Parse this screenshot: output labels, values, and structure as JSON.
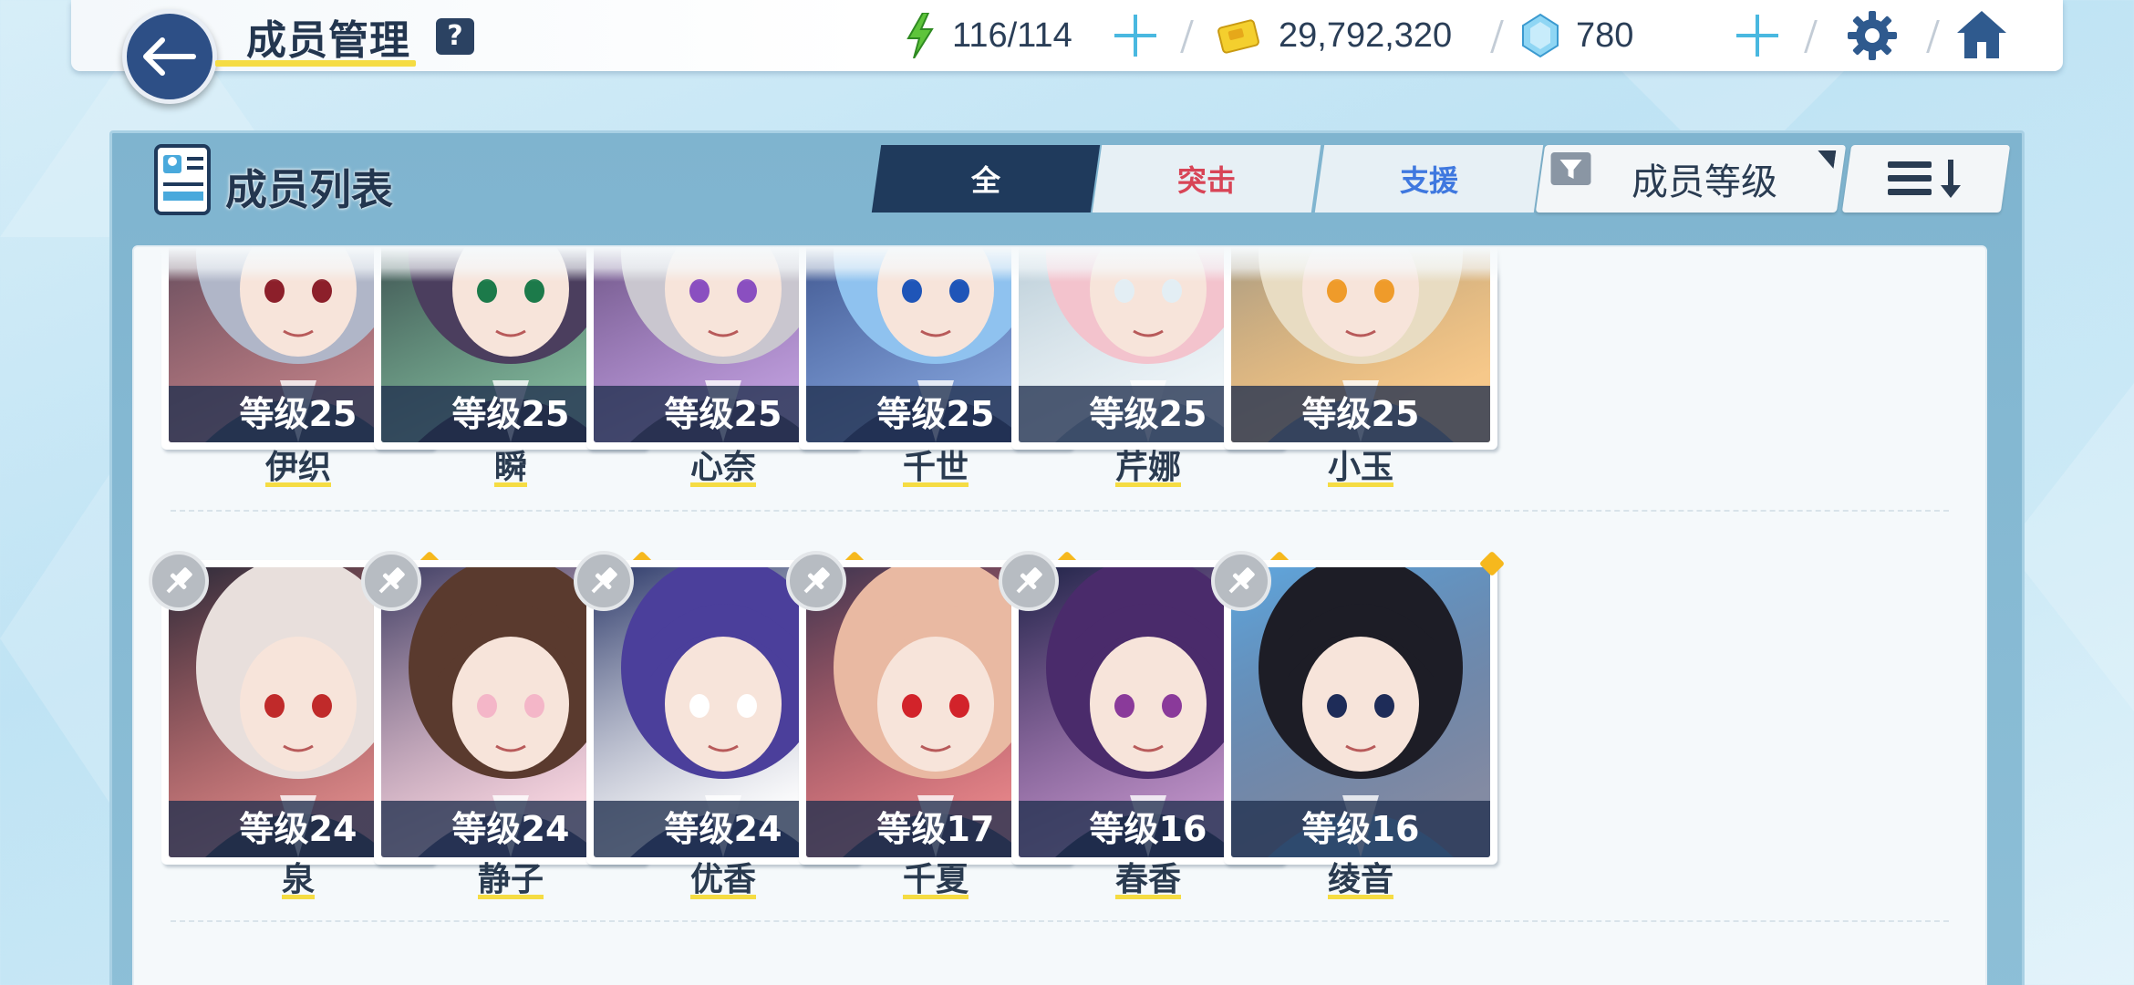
{
  "header": {
    "title": "成员管理",
    "help": "?",
    "ap": "116/114",
    "credits": "29,792,320",
    "gems": "780"
  },
  "panel": {
    "title": "成员列表",
    "tabs": [
      "全",
      "突击",
      "支援"
    ],
    "sort_label": "成员等级"
  },
  "members": [
    {
      "name": "伊织",
      "level": "等级25",
      "art": [
        "#3a3f55",
        "#b0b6c8",
        "#8c1f2a"
      ]
    },
    {
      "name": "瞬",
      "level": "等级25",
      "art": [
        "#2a2436",
        "#4b3e5e",
        "#1c7a4a"
      ]
    },
    {
      "name": "心奈",
      "level": "等级25",
      "art": [
        "#4a3a5a",
        "#c9c6cf",
        "#8a4fc0"
      ]
    },
    {
      "name": "千世",
      "level": "等级25",
      "art": [
        "#2c3a6b",
        "#8fc2ef",
        "#1f55b8"
      ]
    },
    {
      "name": "芹娜",
      "level": "等级25",
      "art": [
        "#9fb8c6",
        "#f3c3cd",
        "#e3eef4"
      ]
    },
    {
      "name": "小玉",
      "level": "等级25",
      "art": [
        "#7e8a90",
        "#e8dcc2",
        "#ef9b2a"
      ]
    },
    {
      "name": "泉",
      "level": "等级24",
      "art": [
        "#2b2b3a",
        "#e8dfdc",
        "#c02a2a"
      ]
    },
    {
      "name": "静子",
      "level": "等级24",
      "art": [
        "#3d3d63",
        "#5a3a2e",
        "#f4b6c8"
      ]
    },
    {
      "name": "优香",
      "level": "等级24",
      "art": [
        "#2a3768",
        "#4b3f9b",
        "#ffffff"
      ]
    },
    {
      "name": "千夏",
      "level": "等级17",
      "art": [
        "#3c3550",
        "#e9b9a2",
        "#d2232a"
      ]
    },
    {
      "name": "春香",
      "level": "等级16",
      "art": [
        "#1e2347",
        "#4a2b6b",
        "#8a3a9a"
      ]
    },
    {
      "name": "绫音",
      "level": "等级16",
      "art": [
        "#5fa8e0",
        "#1d1d26",
        "#1e2c58"
      ]
    }
  ]
}
